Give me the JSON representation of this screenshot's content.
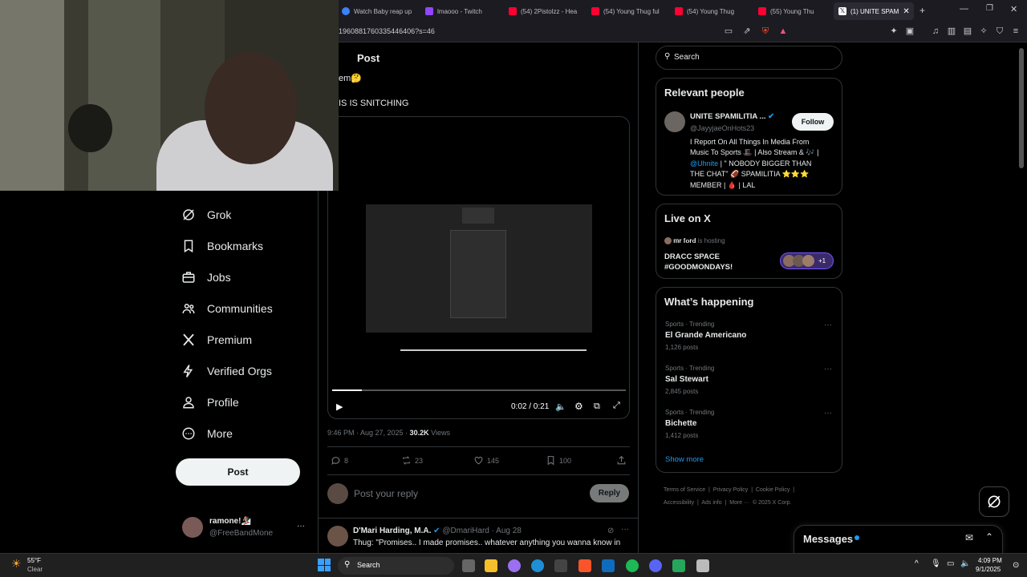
{
  "browser": {
    "tabs": [
      {
        "label": "Watch Baby reap up",
        "color": "#3b82f6"
      },
      {
        "label": "lmaooo - Twitch",
        "color": "#9146ff"
      },
      {
        "label": "(54) 2Pistolzz - Hea",
        "color": "#ff0033"
      },
      {
        "label": "(54) Young Thug ful",
        "color": "#ff0033"
      },
      {
        "label": "(54) Young Thug",
        "color": "#ff0033"
      },
      {
        "label": "(55) Young Thu",
        "color": "#ff0033"
      },
      {
        "label": "(1) UNITE SPAM",
        "color": "#ffffff"
      }
    ],
    "url": "1960881760335446406?s=46"
  },
  "header": {
    "title": "Post"
  },
  "post": {
    "line1": "em🤔",
    "line2": "IS IS SNITCHING",
    "video_time": "0:02 / 0:21",
    "video_progress": 0.1,
    "timestamp": "9:46 PM · Aug 27, 2025 · ",
    "views_count": "30.2K",
    "views_label": " Views",
    "replies": "8",
    "reposts": "23",
    "likes": "145",
    "bookmarks": "100"
  },
  "reply_box": {
    "placeholder": "Post your reply",
    "button": "Reply"
  },
  "reply": {
    "name": "D'Mari Harding, M.A.",
    "handle": "@DmariHard · Aug 28",
    "text": "Thug: \"Promises.. I made promises.. whatever anything you wanna know in"
  },
  "nav": {
    "items": [
      "Grok",
      "Bookmarks",
      "Jobs",
      "Communities",
      "Premium",
      "Verified Orgs",
      "Profile",
      "More"
    ],
    "post_button": "Post"
  },
  "account": {
    "name": "ramone!🏂",
    "handle": "@FreeBandMone",
    "more": "···"
  },
  "search": {
    "placeholder": "Search"
  },
  "relevant": {
    "title": "Relevant people",
    "name": "UNITE SPAMILITIA ...",
    "handle": "@JayyjaeOnHots23",
    "follow": "Follow",
    "bio1": "I Report On All Things In Media From",
    "bio2": "Music To Sports 🎩 | Also Stream & 🎶 |",
    "bio_link": "@Uhnite",
    "bio3": " | \" NOBODY BIGGER THAN",
    "bio4": "THE CHAT\" 🏈 SPAMILITIA ⭐⭐⭐",
    "bio5": "MEMBER | 🩸 | LAL"
  },
  "live": {
    "title": "Live on X",
    "host": "𝐦𝐫 𝐟𝐨𝐫𝐝",
    "hosting": " is hosting",
    "space1": "DRACC SPACE",
    "space2": "#GOODMONDAYS!",
    "plus": "+1"
  },
  "happening": {
    "title": "What’s happening",
    "trends": [
      {
        "category": "Sports · Trending",
        "name": "El Grande Americano",
        "count": "1,126 posts"
      },
      {
        "category": "Sports · Trending",
        "name": "Sal Stewart",
        "count": "2,845 posts"
      },
      {
        "category": "Sports · Trending",
        "name": "Bichette",
        "count": "1,412 posts"
      }
    ],
    "show_more": "Show more"
  },
  "footer": {
    "links": [
      "Terms of Service",
      "Privacy Policy",
      "Cookie Policy",
      "Accessibility",
      "Ads info",
      "More ···"
    ],
    "copyright": "© 2025 X Corp."
  },
  "messages": {
    "title": "Messages"
  },
  "taskbar": {
    "weather_temp": "55°F",
    "weather_desc": "Clear",
    "search": "Search",
    "time": "4:09 PM",
    "date": "9/1/2025"
  }
}
